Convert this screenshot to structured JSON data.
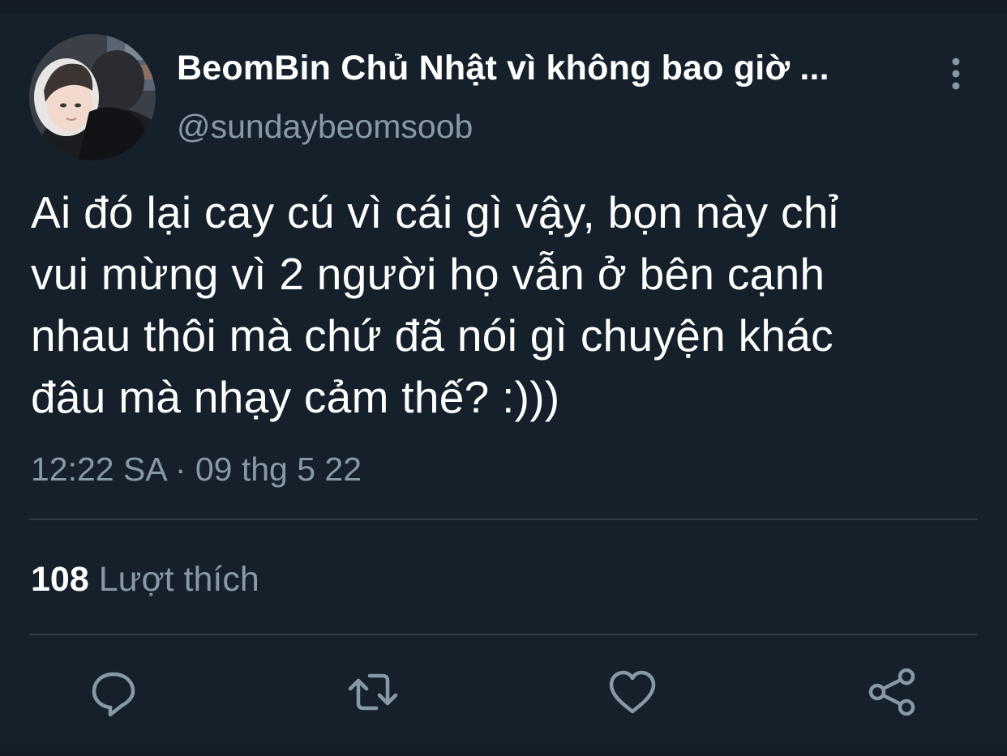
{
  "tweet": {
    "author": {
      "display_name": "BeomBin Chủ Nhật vì không bao giờ ...",
      "handle": "@sundaybeomsoob"
    },
    "text": "Ai đó lại cay cú vì cái gì vậy, bọn này chỉ\nvui mừng vì 2 người họ vẫn ở bên cạnh\nnhau thôi mà chứ đã nói gì chuyện khác\nđâu mà nhạy cảm thế? :)))",
    "timestamp": "12:22 SA · 09 thg 5 22",
    "stats": {
      "likes_count": "108",
      "likes_label": "Lượt thích"
    },
    "actions": {
      "reply_icon": "reply-icon",
      "retweet_icon": "retweet-icon",
      "like_icon": "heart-icon",
      "share_icon": "share-icon"
    }
  },
  "colors": {
    "background": "#15202b",
    "primary_text": "#ffffff",
    "secondary_text": "#8899a6",
    "divider": "#2f3b47",
    "icon": "#8899a6"
  }
}
